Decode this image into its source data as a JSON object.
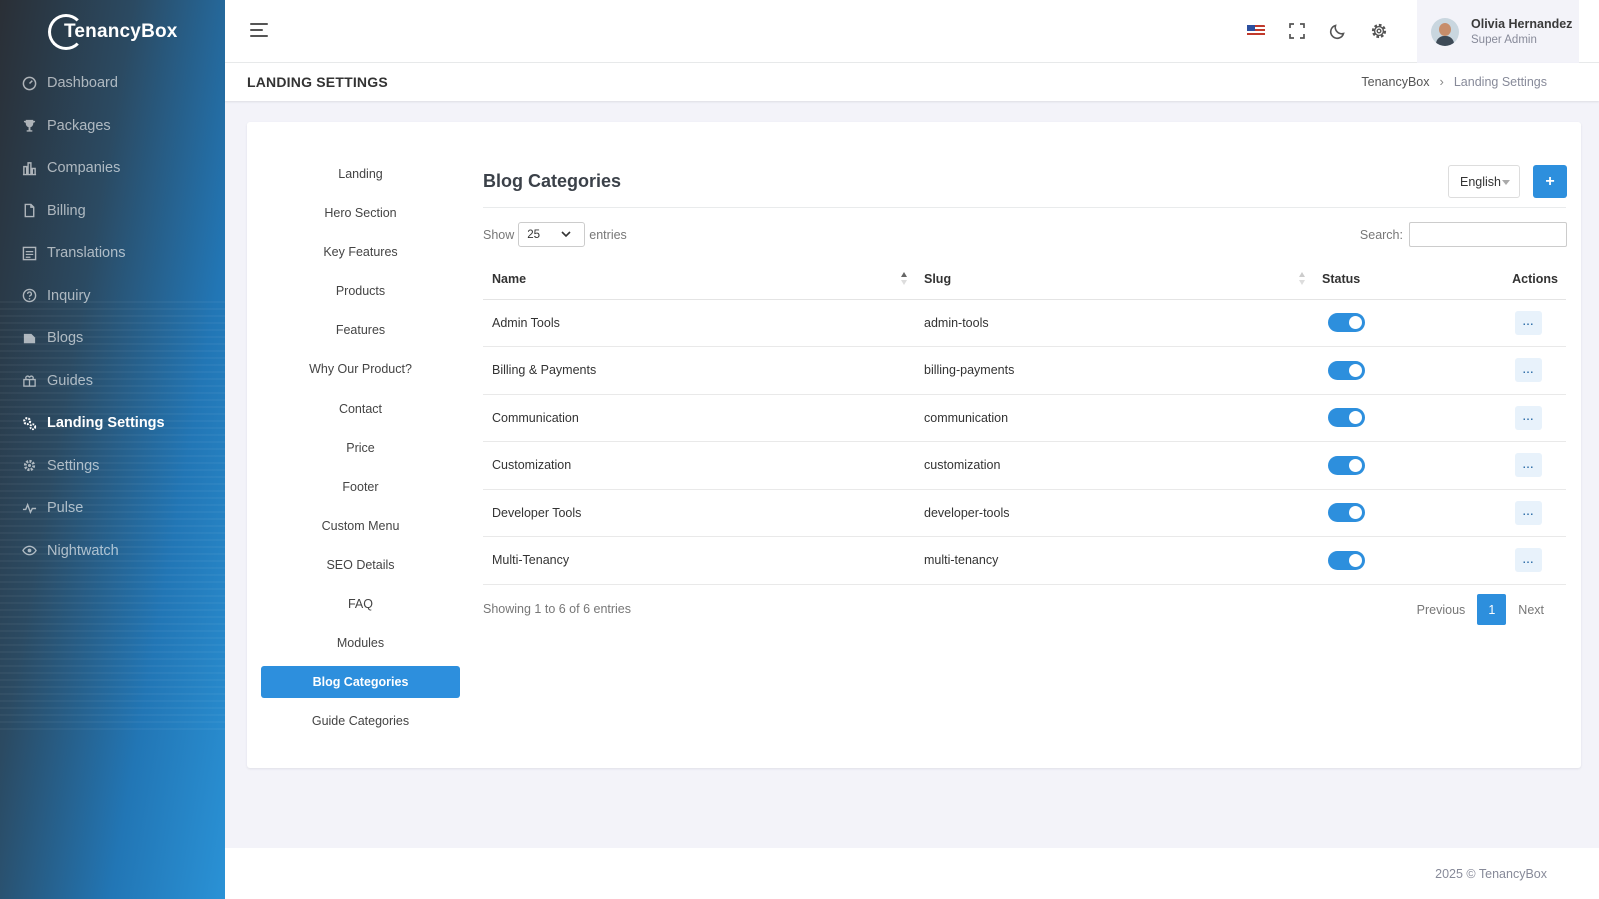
{
  "brand": {
    "name": "TenancyBox"
  },
  "sidebar": {
    "items": [
      {
        "label": "Dashboard",
        "icon": "dashboard-icon"
      },
      {
        "label": "Packages",
        "icon": "trophy-icon"
      },
      {
        "label": "Companies",
        "icon": "building-icon"
      },
      {
        "label": "Billing",
        "icon": "file-icon"
      },
      {
        "label": "Translations",
        "icon": "translate-icon"
      },
      {
        "label": "Inquiry",
        "icon": "question-icon"
      },
      {
        "label": "Blogs",
        "icon": "blog-icon"
      },
      {
        "label": "Guides",
        "icon": "guide-icon"
      },
      {
        "label": "Landing Settings",
        "icon": "gears-icon",
        "active": true
      },
      {
        "label": "Settings",
        "icon": "gear-icon"
      },
      {
        "label": "Pulse",
        "icon": "pulse-icon"
      },
      {
        "label": "Nightwatch",
        "icon": "eye-icon"
      }
    ]
  },
  "header": {
    "user": {
      "name": "Olivia Hernandez",
      "role": "Super Admin"
    }
  },
  "page": {
    "title": "LANDING SETTINGS",
    "breadcrumb": [
      "TenancyBox",
      "Landing Settings"
    ]
  },
  "submenu": {
    "items": [
      "Landing",
      "Hero Section",
      "Key Features",
      "Products",
      "Features",
      "Why Our Product?",
      "Contact",
      "Price",
      "Footer",
      "Custom Menu",
      "SEO Details",
      "FAQ",
      "Modules",
      "Blog Categories",
      "Guide Categories"
    ],
    "active_index": 13
  },
  "panel": {
    "title": "Blog Categories",
    "language": "English",
    "add_label": "+",
    "show_label": "Show",
    "entries_value": "25",
    "entries_label": "entries",
    "search_label": "Search:",
    "search_value": "",
    "columns": {
      "name": "Name",
      "slug": "Slug",
      "status": "Status",
      "actions": "Actions"
    },
    "rows": [
      {
        "name": "Admin Tools",
        "slug": "admin-tools",
        "status": true,
        "action": "..."
      },
      {
        "name": "Billing & Payments",
        "slug": "billing-payments",
        "status": true,
        "action": "..."
      },
      {
        "name": "Communication",
        "slug": "communication",
        "status": true,
        "action": "..."
      },
      {
        "name": "Customization",
        "slug": "customization",
        "status": true,
        "action": "..."
      },
      {
        "name": "Developer Tools",
        "slug": "developer-tools",
        "status": true,
        "action": "..."
      },
      {
        "name": "Multi-Tenancy",
        "slug": "multi-tenancy",
        "status": true,
        "action": "..."
      }
    ],
    "info": "Showing 1 to 6 of 6 entries",
    "pager": {
      "previous": "Previous",
      "page": "1",
      "next": "Next"
    }
  },
  "footer": {
    "text": "2025 © TenancyBox"
  },
  "colors": {
    "primary": "#2d8fdd",
    "sidebar_dark": "#2a2f36",
    "sidebar_light": "#2a92d6"
  }
}
